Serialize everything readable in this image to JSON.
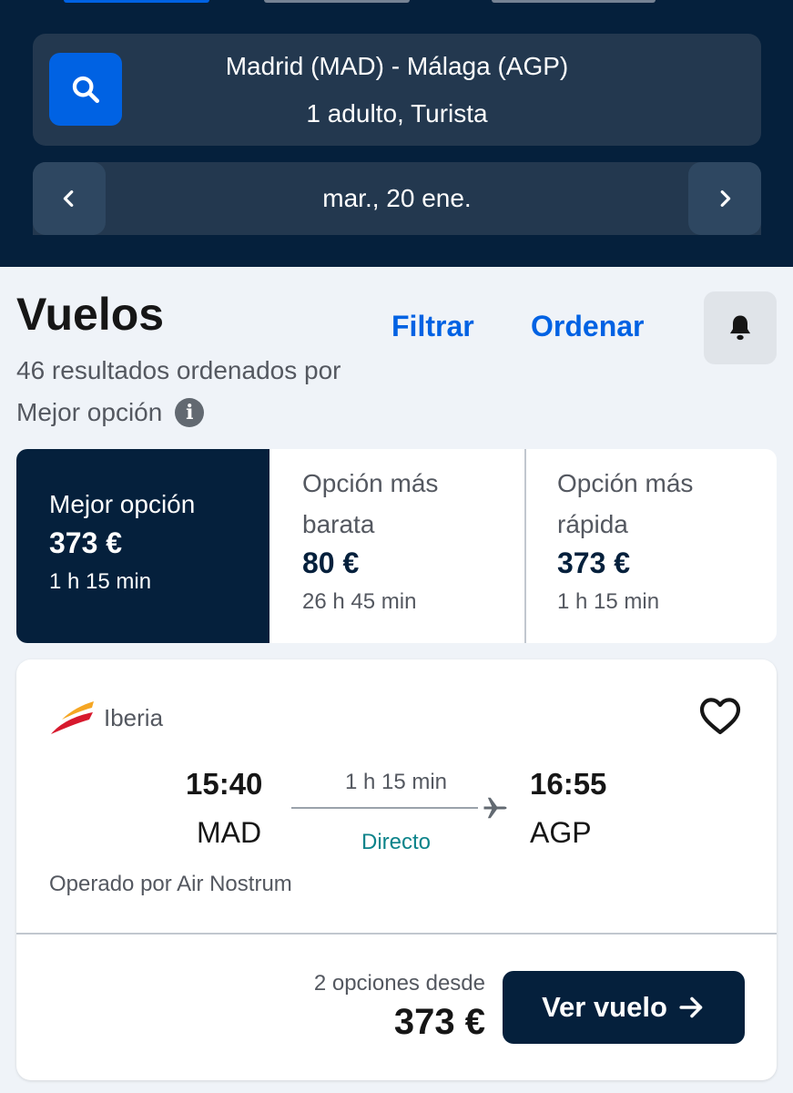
{
  "search": {
    "route": "Madrid (MAD) - Málaga (AGP)",
    "passengers": "1 adulto, Turista",
    "date": "mar., 20 ene."
  },
  "results": {
    "title": "Vuelos",
    "filter_label": "Filtrar",
    "sort_label": "Ordenar",
    "count_text": "46 resultados ordenados por",
    "sort_mode": "Mejor opción"
  },
  "sort_tabs": [
    {
      "name": "Mejor opción",
      "price": "373 €",
      "duration": "1 h 15 min",
      "active": true
    },
    {
      "name_line1": "Opción más",
      "name_line2": "barata",
      "price": "80 €",
      "duration": "26 h 45 min",
      "active": false
    },
    {
      "name_line1": "Opción más",
      "name_line2": "rápida",
      "price": "373 €",
      "duration": "1 h 15 min",
      "active": false
    }
  ],
  "flight": {
    "airline": "Iberia",
    "departure_time": "15:40",
    "departure_code": "MAD",
    "arrival_time": "16:55",
    "arrival_code": "AGP",
    "duration": "1 h 15 min",
    "stops": "Directo",
    "operated_by": "Operado por Air Nostrum",
    "options_text": "2 opciones desde",
    "price": "373 €",
    "cta_label": "Ver vuelo"
  },
  "icons": {
    "search": "search-icon",
    "prev": "chevron-left-icon",
    "next": "chevron-right-icon",
    "bell": "bell-icon",
    "info": "info-icon",
    "heart": "heart-icon",
    "plane": "plane-icon",
    "arrow": "arrow-right-icon",
    "logo": "iberia-logo"
  },
  "colors": {
    "header_bg": "#05203c",
    "accent": "#0062e3",
    "field_bg": "#23384f",
    "direct": "#0c838a"
  }
}
